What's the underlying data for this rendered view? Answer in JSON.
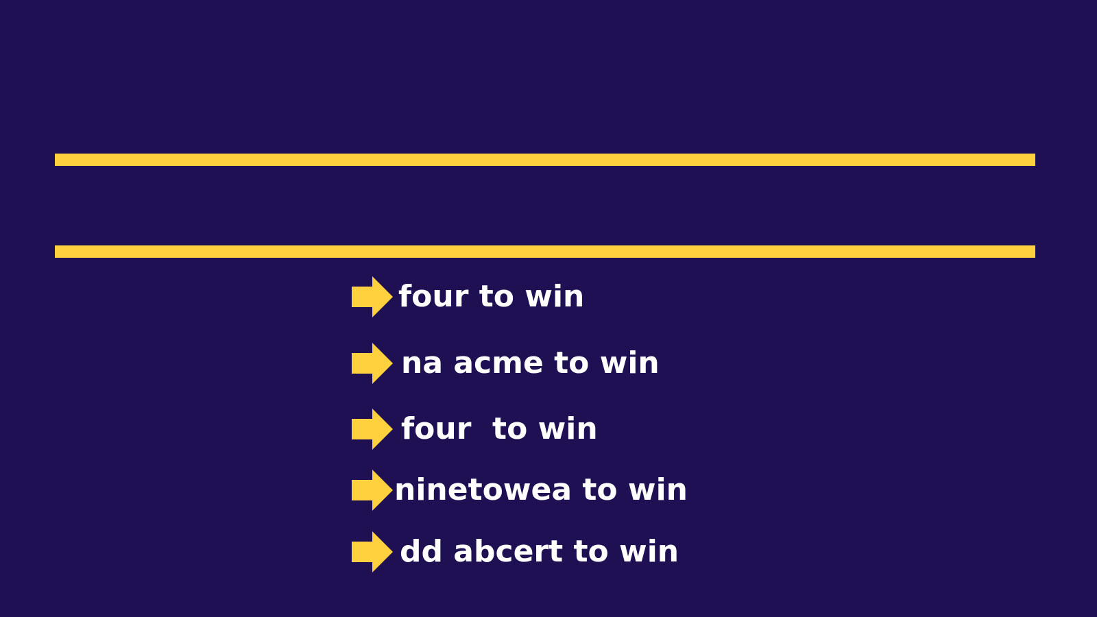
{
  "colors": {
    "background": "#1e1053",
    "accent": "#ffd13f",
    "text": "#ffffff"
  },
  "icons": {
    "bullet": "arrow-right-icon"
  },
  "list": {
    "items": [
      {
        "label": "four to win"
      },
      {
        "label": "na acme to win"
      },
      {
        "label": "four  to win"
      },
      {
        "label": "ninetowea to win"
      },
      {
        "label": "dd abcert to win"
      }
    ]
  }
}
